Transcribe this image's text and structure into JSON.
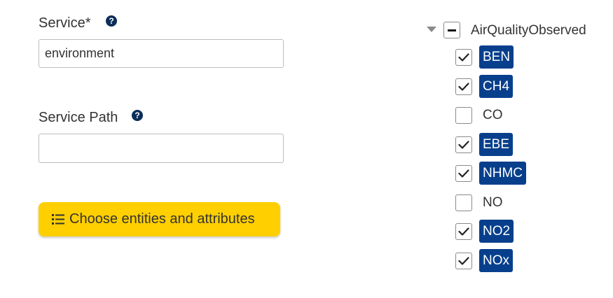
{
  "form": {
    "service_label": "Service*",
    "service_value": "environment",
    "service_path_label": "Service Path",
    "service_path_value": "",
    "help_glyph": "?",
    "choose_button_label": "Choose entities and attributes"
  },
  "tree": {
    "root_label": "AirQualityObserved",
    "root_state": "indeterminate",
    "expanded": true,
    "items": [
      {
        "label": "BEN",
        "checked": true
      },
      {
        "label": "CH4",
        "checked": true
      },
      {
        "label": "CO",
        "checked": false
      },
      {
        "label": "EBE",
        "checked": true
      },
      {
        "label": "NHMC",
        "checked": true
      },
      {
        "label": "NO",
        "checked": false
      },
      {
        "label": "NO2",
        "checked": true
      },
      {
        "label": "NOx",
        "checked": true
      }
    ]
  },
  "colors": {
    "accent_button": "#ffcf00",
    "selected_tag": "#073f8c",
    "help_icon": "#0b2e5a"
  }
}
